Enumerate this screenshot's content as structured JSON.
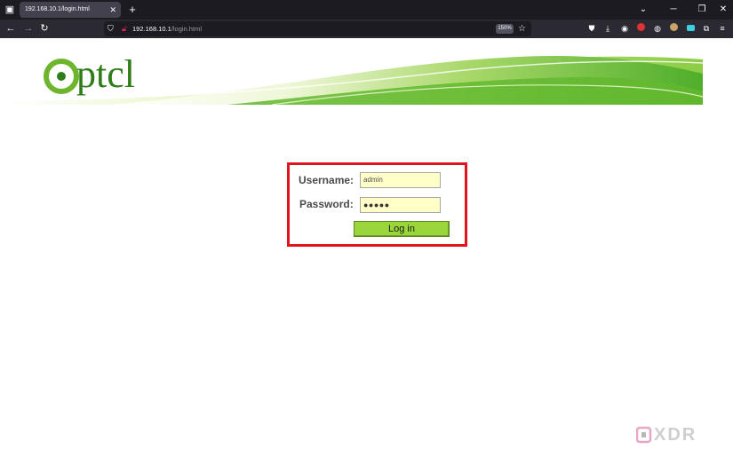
{
  "browser": {
    "tab_title": "192.168.10.1/login.html",
    "tab_close": "✕",
    "new_tab": "+",
    "url_host": "192.168.10.1",
    "url_path": "/login.html",
    "zoom": "150%"
  },
  "brand": {
    "logo_text": "ptcl",
    "colors": {
      "green": "#6db52d",
      "dark_green": "#2e7d18",
      "light_green": "#cfe89a"
    }
  },
  "login": {
    "username_label": "Username:",
    "password_label": "Password:",
    "username_value": "admin",
    "password_value": "●●●●●",
    "button_label": "Log in",
    "frame_color": "#e0141f"
  },
  "watermark": {
    "text": "XDR"
  }
}
